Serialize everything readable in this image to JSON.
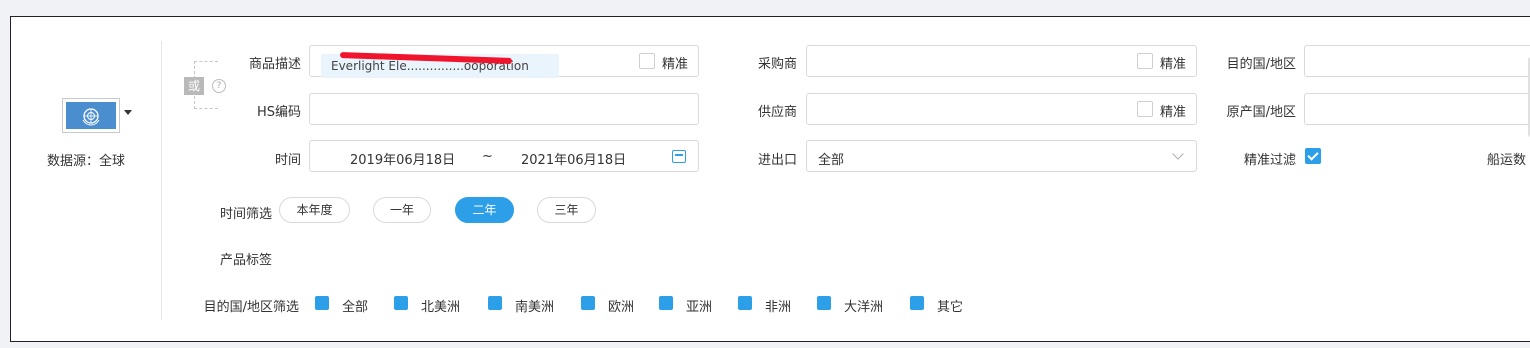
{
  "data_source": {
    "flag": "un-flag-icon",
    "label": "数据源：全球"
  },
  "or_group": {
    "badge": "或",
    "help": "?"
  },
  "fields": {
    "product_desc": {
      "label": "商品描述",
      "tag_text": "Everlight Ele...............ooporation",
      "precise": "精准"
    },
    "buyer": {
      "label": "采购商",
      "precise": "精准"
    },
    "destination": {
      "label": "目的国/地区"
    },
    "hs_code": {
      "label": "HS编码"
    },
    "supplier": {
      "label": "供应商",
      "precise": "精准"
    },
    "origin": {
      "label": "原产国/地区"
    },
    "time": {
      "label": "时间",
      "start": "2019年06月18日",
      "separator": "~",
      "end": "2021年06月18日"
    },
    "import_export": {
      "label": "进出口",
      "value": "全部"
    },
    "precise_filter": {
      "label": "精准过滤",
      "checked": true
    },
    "shipping_partial": "船运数"
  },
  "time_filter": {
    "label": "时间筛选",
    "options": [
      "本年度",
      "一年",
      "二年",
      "三年"
    ],
    "selected": "二年"
  },
  "product_tags": {
    "label": "产品标签"
  },
  "region_filter": {
    "label": "目的国/地区筛选",
    "options": [
      "全部",
      "北美洲",
      "南美洲",
      "欧洲",
      "亚洲",
      "非洲",
      "大洋洲",
      "其它"
    ]
  },
  "colors": {
    "accent": "#2d9ee8",
    "redaction": "#f0142c"
  }
}
